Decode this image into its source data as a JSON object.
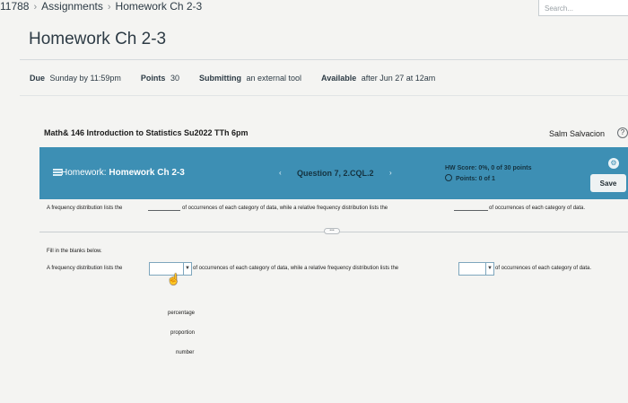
{
  "breadcrumb": {
    "course": "11788",
    "assignments": "Assignments",
    "current": "Homework Ch 2-3"
  },
  "search": {
    "placeholder": "Search..."
  },
  "page": {
    "title": "Homework Ch 2-3"
  },
  "details": {
    "due_label": "Due",
    "due_value": "Sunday by 11:59pm",
    "points_label": "Points",
    "points_value": "30",
    "submitting_label": "Submitting",
    "submitting_value": "an external tool",
    "available_label": "Available",
    "available_value": "after Jun 27 at 12am"
  },
  "course_header": {
    "course_name": "Math& 146 Introduction to Statistics Su2022 TTh 6pm",
    "user_name": "Salm Salvacion",
    "help_glyph": "?"
  },
  "hw_bar": {
    "homework_prefix": "Homework:",
    "homework_name": "Homework Ch 2-3",
    "question_label": "Question 7, 2.CQL.2",
    "hw_score": "HW Score: 0%, 0 of 30 points",
    "points": "Points: 0 of 1",
    "save_label": "Save",
    "prev_glyph": "‹",
    "next_glyph": "›",
    "settings_glyph": "⚙",
    "color": "#3d8fb4"
  },
  "statement": {
    "part1": "A frequency distribution lists the",
    "part2": "of occurrences of each category of data, while a relative frequency distribution lists the",
    "part3": "of occurrences of each category of data."
  },
  "expand_glyph": "•••",
  "instructions": "Fill in the blanks below.",
  "question": {
    "part1": "A frequency distribution lists the",
    "part2": "of occurrences of each category of data, while a relative frequency distribution lists the",
    "part3": "of occurrences of each category of data.",
    "dropdown_glyph": "▼"
  },
  "dropdown_options": [
    "percentage",
    "proportion",
    "number"
  ]
}
